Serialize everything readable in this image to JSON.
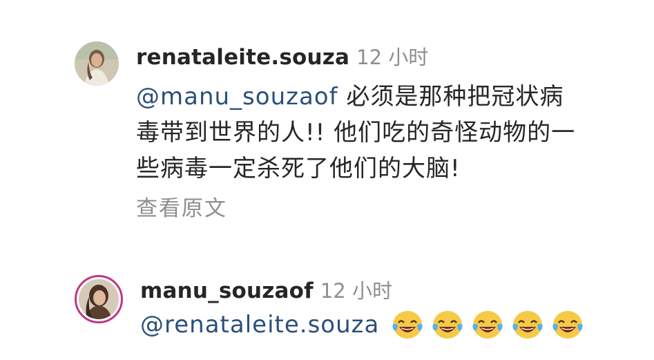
{
  "comments": [
    {
      "username": "renataleite.souza",
      "time": "12 小时",
      "mention": "@manu_souzaof",
      "text": " 必须是那种把冠状病毒带到世界的人!! 他们吃的奇怪动物的一些病毒一定杀死了他们的大脑!",
      "see_original": "查看原文",
      "avatar_icon": "user-avatar-icon"
    },
    {
      "username": "manu_souzaof",
      "time": "12 小时",
      "mention": "@renataleite.souza",
      "emojis": [
        "😂",
        "😂",
        "😂",
        "😂",
        "😂"
      ],
      "emoji_icon": "face-with-tears-of-joy-icon",
      "avatar_icon": "user-avatar-icon"
    }
  ],
  "colors": {
    "mention": "#2b4f7a",
    "username": "#262626",
    "muted": "#8e8e8e",
    "story_ring": "#c13584"
  }
}
